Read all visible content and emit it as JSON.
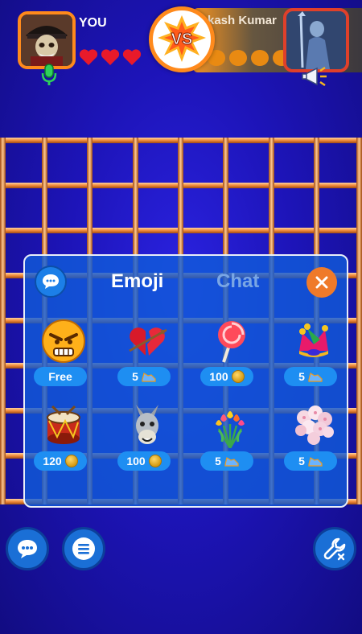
{
  "player": {
    "name": "YOU",
    "lives": 3
  },
  "opponent": {
    "name": "kash Kumar",
    "lives": 4
  },
  "vs_text": "VS",
  "panel": {
    "tabs": {
      "emoji": "Emoji",
      "chat": "Chat"
    },
    "active_tab": "Emoji",
    "items": [
      {
        "icon": "angry-face-icon",
        "price": "Free",
        "currency": "none"
      },
      {
        "icon": "broken-heart-arrow-icon",
        "price": "5",
        "currency": "shoe"
      },
      {
        "icon": "lollipop-icon",
        "price": "100",
        "currency": "coin"
      },
      {
        "icon": "jester-hat-icon",
        "price": "5",
        "currency": "shoe"
      },
      {
        "icon": "drum-icon",
        "price": "120",
        "currency": "coin"
      },
      {
        "icon": "donkey-icon",
        "price": "100",
        "currency": "coin"
      },
      {
        "icon": "tulip-bouquet-icon",
        "price": "5",
        "currency": "shoe"
      },
      {
        "icon": "flower-bouquet-icon",
        "price": "5",
        "currency": "shoe"
      }
    ]
  },
  "colors": {
    "accent": "#ff8a1c",
    "panel": "#105cda",
    "price_pill": "#1e8ef2",
    "close": "#ef7a2a",
    "grid": "#f0a05a"
  }
}
